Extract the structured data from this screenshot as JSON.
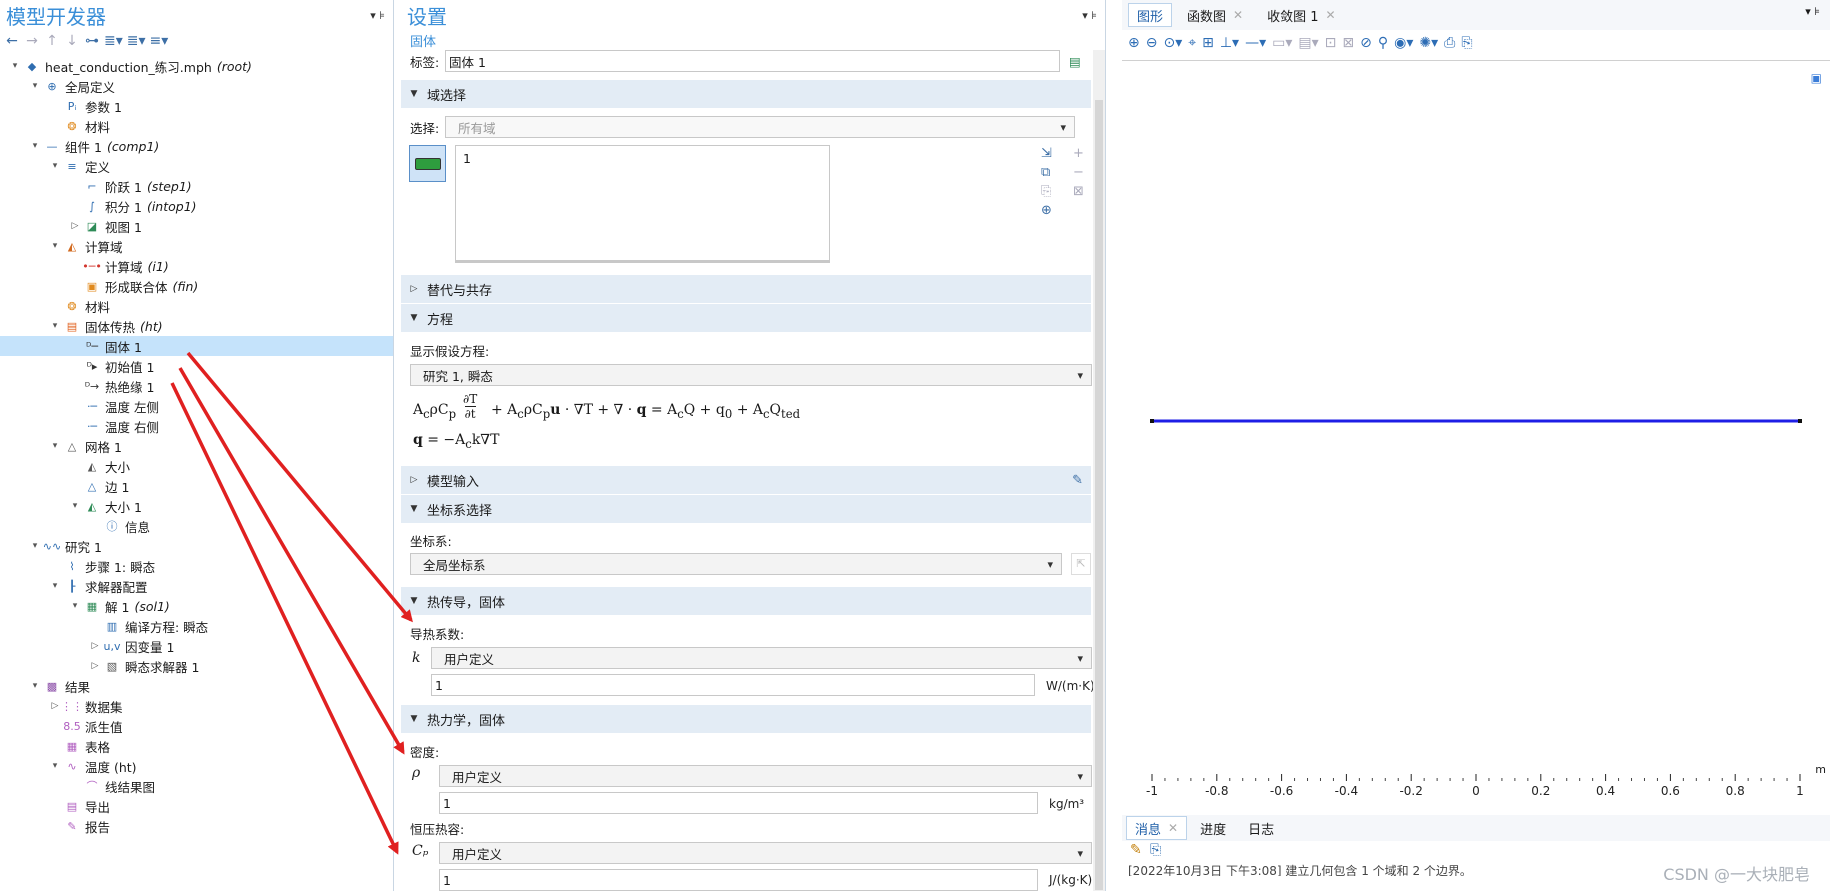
{
  "model_builder": {
    "title": "模型开发器",
    "tree": [
      {
        "label": "heat_conduction_练习.mph",
        "sub": "(root)",
        "icon": "mph-file-icon",
        "glyph": "◆",
        "color": "#2f6db0"
      },
      {
        "label": "全局定义",
        "sub": "",
        "icon": "globe-icon",
        "glyph": "⊕",
        "color": "#2f6db0"
      },
      {
        "label": "参数 1",
        "sub": "",
        "icon": "parameter-icon",
        "glyph": "Pᵢ",
        "color": "#2f6db0"
      },
      {
        "label": "材料",
        "sub": "",
        "icon": "materials-icon",
        "glyph": "❂",
        "color": "#e08a1e"
      },
      {
        "label": "组件 1",
        "sub": "(comp1)",
        "icon": "component-icon",
        "glyph": "—",
        "color": "#2f6db0"
      },
      {
        "label": "定义",
        "sub": "",
        "icon": "definitions-icon",
        "glyph": "≡",
        "color": "#2f6db0"
      },
      {
        "label": "阶跃 1",
        "sub": "(step1)",
        "icon": "step-function-icon",
        "glyph": "⌐",
        "color": "#2f6db0"
      },
      {
        "label": "积分 1",
        "sub": "(intop1)",
        "icon": "integration-icon",
        "glyph": "∫",
        "color": "#2f6db0"
      },
      {
        "label": "视图 1",
        "sub": "",
        "icon": "view-icon",
        "glyph": "◪",
        "color": "#2e8b57"
      },
      {
        "label": "计算域",
        "sub": "",
        "icon": "geometry-icon",
        "glyph": "◭",
        "color": "#d2691e"
      },
      {
        "label": "计算域",
        "sub": "(i1)",
        "icon": "interval-icon",
        "glyph": "•─•",
        "color": "#d2362e"
      },
      {
        "label": "形成联合体",
        "sub": "(fin)",
        "icon": "form-union-icon",
        "glyph": "▣",
        "color": "#e08a1e"
      },
      {
        "label": "材料",
        "sub": "",
        "icon": "materials-icon",
        "glyph": "❂",
        "color": "#e08a1e"
      },
      {
        "label": "固体传热",
        "sub": "(ht)",
        "icon": "heat-transfer-icon",
        "glyph": "▤",
        "color": "#e0601e"
      },
      {
        "label": "固体 1",
        "sub": "",
        "icon": "solid-domain-icon",
        "glyph": "ᴰ─",
        "color": "#333"
      },
      {
        "label": "初始值 1",
        "sub": "",
        "icon": "initial-values-icon",
        "glyph": "ᴰ▸",
        "color": "#333"
      },
      {
        "label": "热绝缘 1",
        "sub": "",
        "icon": "thermal-insulation-icon",
        "glyph": "ᴰ→",
        "color": "#333"
      },
      {
        "label": "温度 左侧",
        "sub": "",
        "icon": "temperature-icon",
        "glyph": "·─",
        "color": "#2f6db0"
      },
      {
        "label": "温度 右侧",
        "sub": "",
        "icon": "temperature-icon",
        "glyph": "·─",
        "color": "#2f6db0"
      },
      {
        "label": "网格 1",
        "sub": "",
        "icon": "mesh-icon",
        "glyph": "△",
        "color": "#555"
      },
      {
        "label": "大小",
        "sub": "",
        "icon": "size-icon",
        "glyph": "◭",
        "color": "#555"
      },
      {
        "label": "边 1",
        "sub": "",
        "icon": "edge-mesh-icon",
        "glyph": "△",
        "color": "#2f6db0"
      },
      {
        "label": "大小 1",
        "sub": "",
        "icon": "size-icon",
        "glyph": "◭",
        "color": "#2e8b57"
      },
      {
        "label": "信息",
        "sub": "",
        "icon": "info-icon",
        "glyph": "ⓘ",
        "color": "#2f6db0"
      },
      {
        "label": "研究 1",
        "sub": "",
        "icon": "study-icon",
        "glyph": "∿∿",
        "color": "#2f6db0"
      },
      {
        "label": "步骤 1: 瞬态",
        "sub": "",
        "icon": "time-dependent-icon",
        "glyph": "⌇",
        "color": "#2f6db0"
      },
      {
        "label": "求解器配置",
        "sub": "",
        "icon": "solver-configurations-icon",
        "glyph": "┠",
        "color": "#2f6db0"
      },
      {
        "label": "解 1",
        "sub": "(sol1)",
        "icon": "solution-icon",
        "glyph": "▦",
        "color": "#2e8b57"
      },
      {
        "label": "编译方程: 瞬态",
        "sub": "",
        "icon": "compile-equations-icon",
        "glyph": "▥",
        "color": "#2f6db0"
      },
      {
        "label": "因变量 1",
        "sub": "",
        "icon": "dependent-variables-icon",
        "glyph": "u,v",
        "color": "#2f6db0"
      },
      {
        "label": "瞬态求解器 1",
        "sub": "",
        "icon": "time-solver-icon",
        "glyph": "▧",
        "color": "#555"
      },
      {
        "label": "结果",
        "sub": "",
        "icon": "results-icon",
        "glyph": "▩",
        "color": "#8b4ea8"
      },
      {
        "label": "数据集",
        "sub": "",
        "icon": "datasets-icon",
        "glyph": "⋮⋮",
        "color": "#b05fc0"
      },
      {
        "label": "派生值",
        "sub": "",
        "icon": "derived-values-icon",
        "glyph": "8.5",
        "color": "#b05fc0"
      },
      {
        "label": "表格",
        "sub": "",
        "icon": "table-icon",
        "glyph": "▦",
        "color": "#b05fc0"
      },
      {
        "label": "温度 (ht)",
        "sub": "",
        "icon": "plot-group-icon",
        "glyph": "∿",
        "color": "#b05fc0"
      },
      {
        "label": "线结果图",
        "sub": "",
        "icon": "line-graph-icon",
        "glyph": "⌒",
        "color": "#b05fc0"
      },
      {
        "label": "导出",
        "sub": "",
        "icon": "export-icon",
        "glyph": "▤",
        "color": "#b05fc0"
      },
      {
        "label": "报告",
        "sub": "",
        "icon": "report-icon",
        "glyph": "✎",
        "color": "#b05fc0"
      }
    ]
  },
  "settings": {
    "title": "设置",
    "subtitle": "固体",
    "label_label": "标签:",
    "label_value": "固体 1",
    "domain_selection": "域选择",
    "selection_label": "选择:",
    "selection_value": "所有域",
    "selection_list_item": "1",
    "override": "替代与共存",
    "equation": "方程",
    "show_equation_label": "显示假设方程:",
    "show_equation_value": "研究 1, 瞬态",
    "model_inputs": "模型输入",
    "coord_section": "坐标系选择",
    "coord_label": "坐标系:",
    "coord_value": "全局坐标系",
    "heat_conduction": "热传导，固体",
    "conductivity_label": "导热系数:",
    "k_symbol": "k",
    "k_mode": "用户定义",
    "k_value": "1",
    "k_unit": "W/(m·K)",
    "thermodynamics": "热力学，固体",
    "density_label": "密度:",
    "rho_symbol": "ρ",
    "rho_mode": "用户定义",
    "rho_value": "1",
    "rho_unit": "kg/m³",
    "cp_label": "恒压热容:",
    "cp_symbol": "Cₚ",
    "cp_mode": "用户定义",
    "cp_value": "1",
    "cp_unit": "J/(kg·K)"
  },
  "graphics": {
    "tabs": [
      {
        "label": "图形",
        "closable": false
      },
      {
        "label": "函数图",
        "closable": true
      },
      {
        "label": "收敛图 1",
        "closable": true
      }
    ],
    "axis_unit": "m",
    "ticks": [
      "-1",
      "-0.8",
      "-0.6",
      "-0.4",
      "-0.2",
      "0",
      "0.2",
      "0.4",
      "0.6",
      "0.8",
      "1"
    ],
    "line_color": "#1e1ee6",
    "arrow_color": "#e02020"
  },
  "messages": {
    "tabs": [
      "消息",
      "进度",
      "日志"
    ],
    "line": "[2022年10月3日 下午3:08] 建立几何包含 1 个域和 2 个边界。"
  },
  "watermark": "CSDN @一大块肥皂"
}
